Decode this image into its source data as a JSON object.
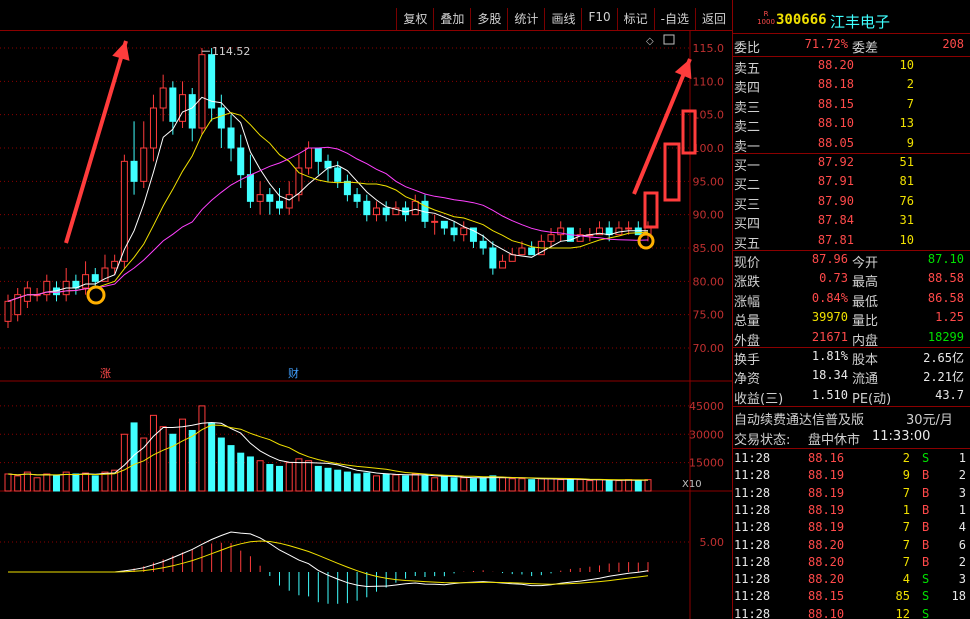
{
  "toolbar": {
    "buttons": [
      "复权",
      "叠加",
      "多股",
      "统计",
      "画线",
      "F10",
      "标记",
      "-自选",
      "返回"
    ]
  },
  "chart": {
    "price_axis": [
      "115.0",
      "110.0",
      "105.0",
      "100.0",
      "95.00",
      "90.00",
      "85.00",
      "80.00",
      "75.00",
      "70.00"
    ],
    "high_label": "114.52",
    "markers": [
      "涨",
      "财"
    ],
    "volume_axis": [
      "45000",
      "30000",
      "15000"
    ],
    "volume_unit": "X10",
    "macd_axis": [
      "5.00"
    ],
    "colors": {
      "up": "#ff3c3c",
      "down": "#40ffff",
      "ma5": "#ffffff",
      "ma10": "#f0e000",
      "ma20": "#ff40ff",
      "grid": "#8b0000"
    }
  },
  "stock": {
    "badge_top": "R",
    "badge_bottom": "1000",
    "code": "300666",
    "name": "江丰电子"
  },
  "ratio": {
    "label1": "委比",
    "value1": "71.72%",
    "label2": "委差",
    "value2": "208"
  },
  "asks": [
    {
      "label": "卖五",
      "price": "88.20",
      "vol": "10"
    },
    {
      "label": "卖四",
      "price": "88.18",
      "vol": "2"
    },
    {
      "label": "卖三",
      "price": "88.15",
      "vol": "7"
    },
    {
      "label": "卖二",
      "price": "88.10",
      "vol": "13"
    },
    {
      "label": "卖一",
      "price": "88.05",
      "vol": "9"
    }
  ],
  "bids": [
    {
      "label": "买一",
      "price": "87.92",
      "vol": "51"
    },
    {
      "label": "买二",
      "price": "87.91",
      "vol": "81"
    },
    {
      "label": "买三",
      "price": "87.90",
      "vol": "76"
    },
    {
      "label": "买四",
      "price": "87.84",
      "vol": "31"
    },
    {
      "label": "买五",
      "price": "87.81",
      "vol": "10"
    }
  ],
  "quote": [
    {
      "l1": "现价",
      "v1": "87.96",
      "l2": "今开",
      "v2": "87.10"
    },
    {
      "l1": "涨跌",
      "v1": "0.73",
      "l2": "最高",
      "v2": "88.58"
    },
    {
      "l1": "涨幅",
      "v1": "0.84%",
      "l2": "最低",
      "v2": "86.58"
    },
    {
      "l1": "总量",
      "v1": "39970",
      "l2": "量比",
      "v2": "1.25"
    },
    {
      "l1": "外盘",
      "v1": "21671",
      "l2": "内盘",
      "v2": "18299"
    }
  ],
  "fundamentals": [
    {
      "l1": "换手",
      "v1": "1.81%",
      "l2": "股本",
      "v2": "2.65亿"
    },
    {
      "l1": "净资",
      "v1": "18.34",
      "l2": "流通",
      "v2": "2.21亿"
    },
    {
      "l1": "收益(三)",
      "v1": "1.510",
      "l2": "PE(动)",
      "v2": "43.7"
    }
  ],
  "promo": {
    "text": "自动续费通达信普及版",
    "price": "30元/月"
  },
  "status": {
    "label": "交易状态:",
    "value": "盘中休市",
    "time": "11:33:00"
  },
  "ticks": [
    {
      "time": "11:28",
      "price": "88.16",
      "vol": "2",
      "side": "S",
      "count": "1"
    },
    {
      "time": "11:28",
      "price": "88.19",
      "vol": "9",
      "side": "B",
      "count": "2"
    },
    {
      "time": "11:28",
      "price": "88.19",
      "vol": "7",
      "side": "B",
      "count": "3"
    },
    {
      "time": "11:28",
      "price": "88.19",
      "vol": "1",
      "side": "B",
      "count": "1"
    },
    {
      "time": "11:28",
      "price": "88.19",
      "vol": "7",
      "side": "B",
      "count": "4"
    },
    {
      "time": "11:28",
      "price": "88.20",
      "vol": "7",
      "side": "B",
      "count": "6"
    },
    {
      "time": "11:28",
      "price": "88.20",
      "vol": "7",
      "side": "B",
      "count": "2"
    },
    {
      "time": "11:28",
      "price": "88.20",
      "vol": "4",
      "side": "S",
      "count": "3"
    },
    {
      "time": "11:28",
      "price": "88.15",
      "vol": "85",
      "side": "S",
      "count": "18"
    },
    {
      "time": "11:28",
      "price": "88.10",
      "vol": "12",
      "side": "S",
      "count": ""
    }
  ]
}
